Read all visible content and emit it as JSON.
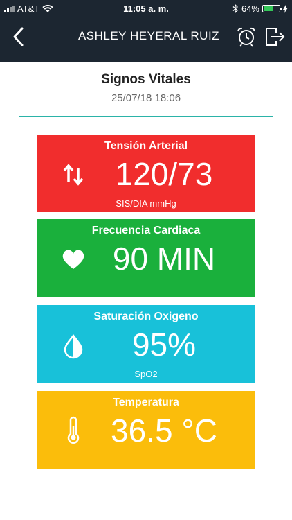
{
  "status_bar": {
    "carrier": "AT&T",
    "time": "11:05 a. m.",
    "battery": "64%",
    "battery_level": 0.64
  },
  "header": {
    "title": "ASHLEY HEYERAL RUIZ",
    "back_icon": "chevron-left-icon",
    "alarm_icon": "alarm-clock-icon",
    "logout_icon": "logout-icon"
  },
  "page": {
    "title": "Signos Vitales",
    "datetime": "25/07/18 18:06"
  },
  "vitals": [
    {
      "title": "Tensión Arterial",
      "value": "120/73",
      "unit": "SIS/DIA mmHg",
      "color": "#f12d2d",
      "icon": "up-down-arrows-icon"
    },
    {
      "title": "Frecuencia Cardiaca",
      "value": "90 MIN",
      "unit": "",
      "color": "#1ab03c",
      "icon": "heart-icon"
    },
    {
      "title": "Saturación Oxigeno",
      "value": "95%",
      "unit": "SpO2",
      "color": "#18c1d9",
      "icon": "contrast-drop-icon"
    },
    {
      "title": "Temperatura",
      "value": "36.5 °C",
      "unit": "",
      "color": "#fbbd0b",
      "icon": "thermometer-icon"
    }
  ]
}
